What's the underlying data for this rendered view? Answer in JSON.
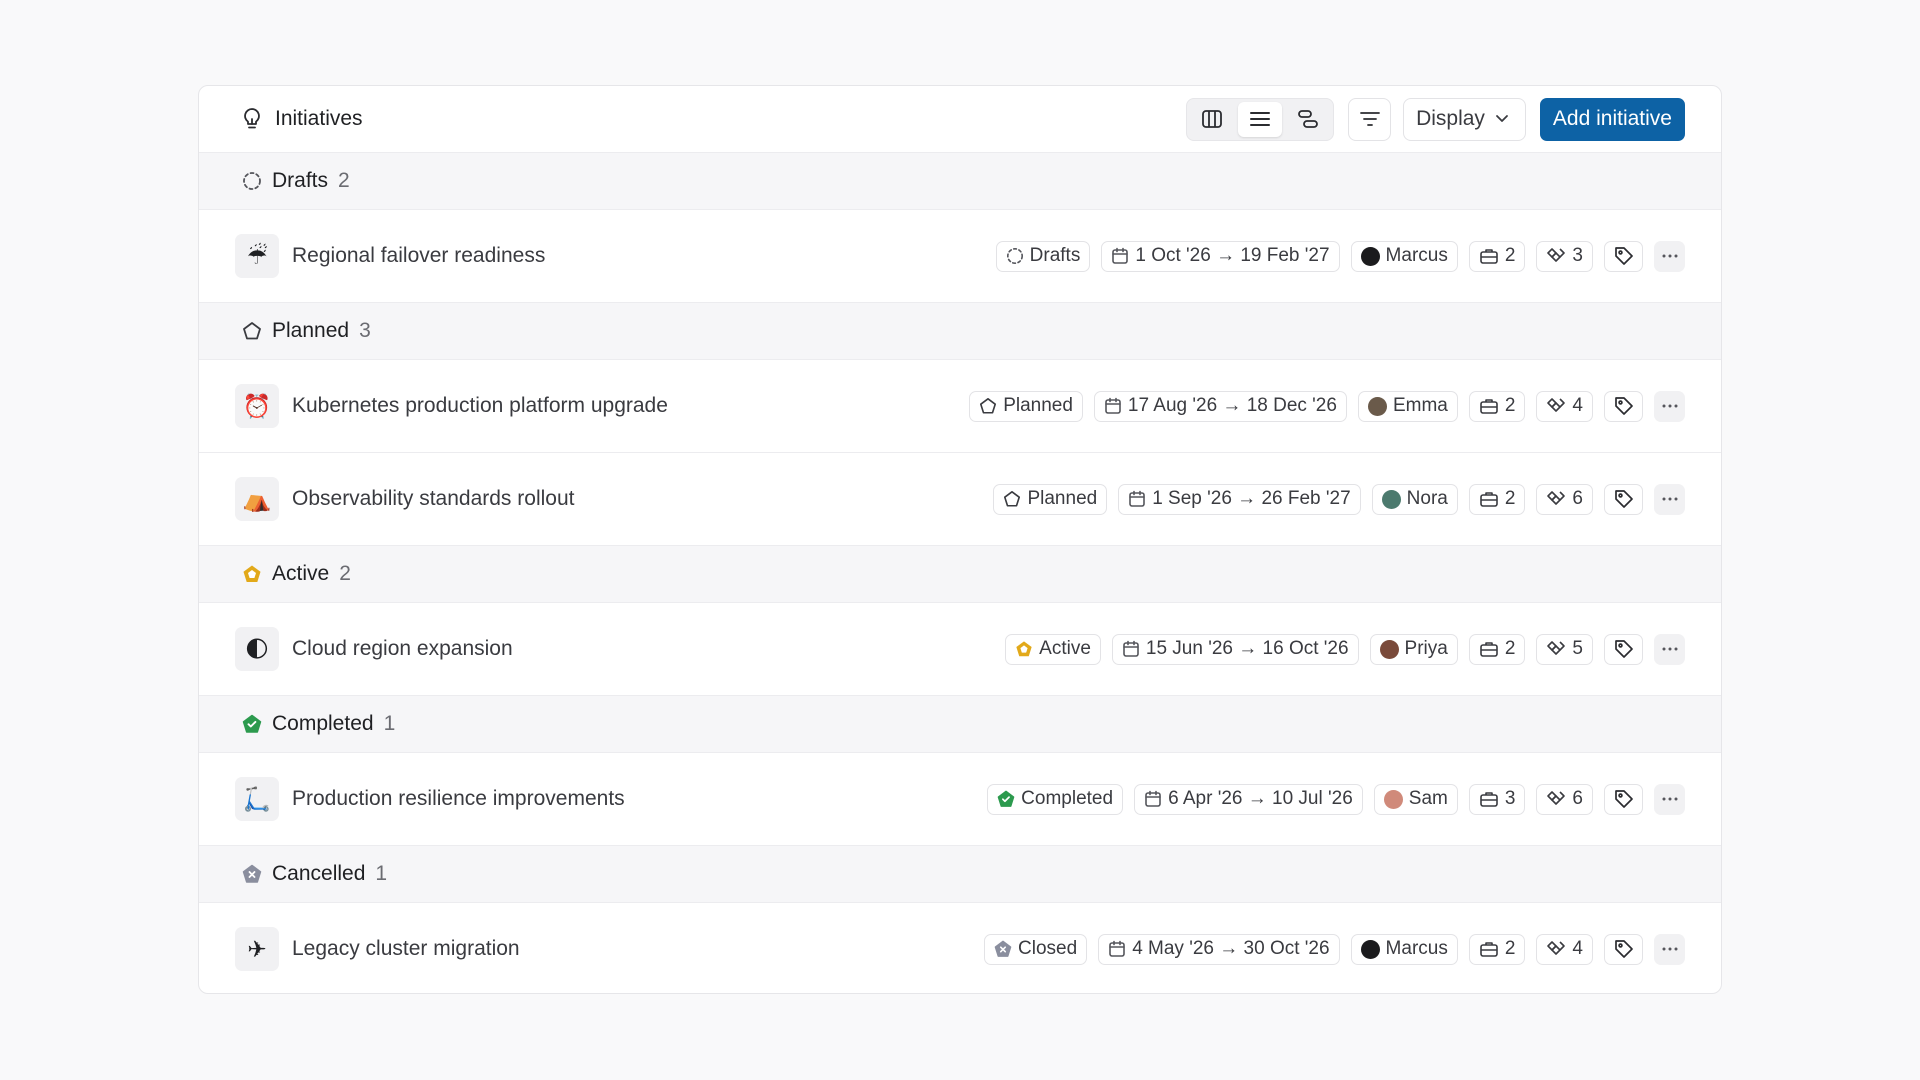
{
  "header": {
    "title": "Initiatives",
    "display_label": "Display",
    "add_label": "Add initiative"
  },
  "colors": {
    "accent": "#0d62a5",
    "active": "#e2a91a",
    "completed": "#2c9a4e",
    "cancelled": "#8a8e9e"
  },
  "groups": [
    {
      "name": "Drafts",
      "count": "2",
      "status_icon": "drafts-dashed-circle-icon",
      "rows": [
        {
          "icon": "☔",
          "title": "Regional failover readiness",
          "status": "Drafts",
          "status_icon": "drafts-dashed-circle-icon",
          "dates": "1 Oct '26 → 19 Feb '27",
          "owner": "Marcus",
          "avatar_color": "#1b1b1d",
          "projects": "2",
          "issues": "3"
        }
      ]
    },
    {
      "name": "Planned",
      "count": "3",
      "status_icon": "planned-pentagon-icon",
      "rows": [
        {
          "icon": "⏰",
          "title": "Kubernetes production platform upgrade",
          "status": "Planned",
          "status_icon": "planned-pentagon-icon",
          "dates": "17 Aug '26 → 18 Dec '26",
          "owner": "Emma",
          "avatar_color": "#6a5a4a",
          "projects": "2",
          "issues": "4"
        },
        {
          "icon": "⛺",
          "title": "Observability standards rollout",
          "status": "Planned",
          "status_icon": "planned-pentagon-icon",
          "dates": "1 Sep '26 → 26 Feb '27",
          "owner": "Nora",
          "avatar_color": "#4c7a6e",
          "projects": "2",
          "issues": "6"
        }
      ]
    },
    {
      "name": "Active",
      "count": "2",
      "status_icon": "active-pentagon-icon",
      "rows": [
        {
          "icon": "🌓",
          "title": "Cloud region expansion",
          "status": "Active",
          "status_icon": "active-pentagon-icon",
          "dates": "15 Jun '26 → 16 Oct '26",
          "owner": "Priya",
          "avatar_color": "#7a4a3a",
          "projects": "2",
          "issues": "5"
        }
      ]
    },
    {
      "name": "Completed",
      "count": "1",
      "status_icon": "completed-check-icon",
      "rows": [
        {
          "icon": "🛴",
          "title": "Production resilience improvements",
          "status": "Completed",
          "status_icon": "completed-check-icon",
          "dates": "6 Apr '26 → 10 Jul '26",
          "owner": "Sam",
          "avatar_color": "#d08a7a",
          "projects": "3",
          "issues": "6"
        }
      ]
    },
    {
      "name": "Cancelled",
      "count": "1",
      "status_icon": "cancelled-x-icon",
      "rows": [
        {
          "icon": "✈",
          "title": "Legacy cluster migration",
          "status": "Closed",
          "status_icon": "cancelled-x-icon",
          "dates": "4 May '26 → 30 Oct '26",
          "owner": "Marcus",
          "avatar_color": "#1b1b1d",
          "projects": "2",
          "issues": "4"
        }
      ]
    }
  ]
}
